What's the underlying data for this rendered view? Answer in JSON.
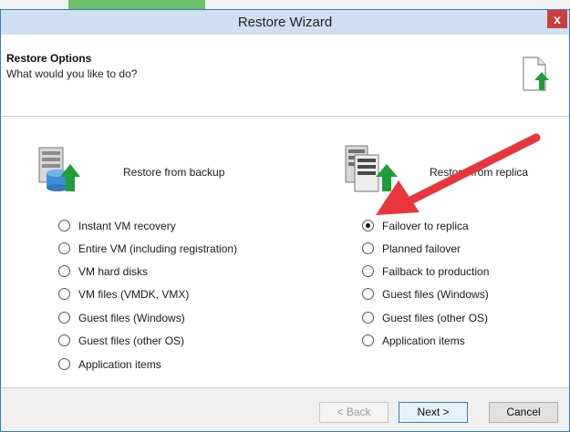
{
  "window": {
    "title": "Restore Wizard",
    "close_label": "x"
  },
  "header": {
    "title": "Restore Options",
    "subtitle": "What would you like to do?"
  },
  "backup": {
    "heading": "Restore from backup",
    "options": [
      "Instant VM recovery",
      "Entire VM (including registration)",
      "VM hard disks",
      "VM files (VMDK, VMX)",
      "Guest files (Windows)",
      "Guest files (other OS)",
      "Application items"
    ]
  },
  "replica": {
    "heading": "Restore from replica",
    "options": [
      "Failover to replica",
      "Planned failover",
      "Failback to production",
      "Guest files (Windows)",
      "Guest files (other OS)",
      "Application items"
    ],
    "selected_index": 0
  },
  "footer": {
    "back_label": "< Back",
    "next_label": "Next >",
    "cancel_label": "Cancel"
  },
  "colors": {
    "arrow": "#e8373c",
    "title_bar": "#cfe0f3",
    "accent_green": "#1f9d3a"
  }
}
